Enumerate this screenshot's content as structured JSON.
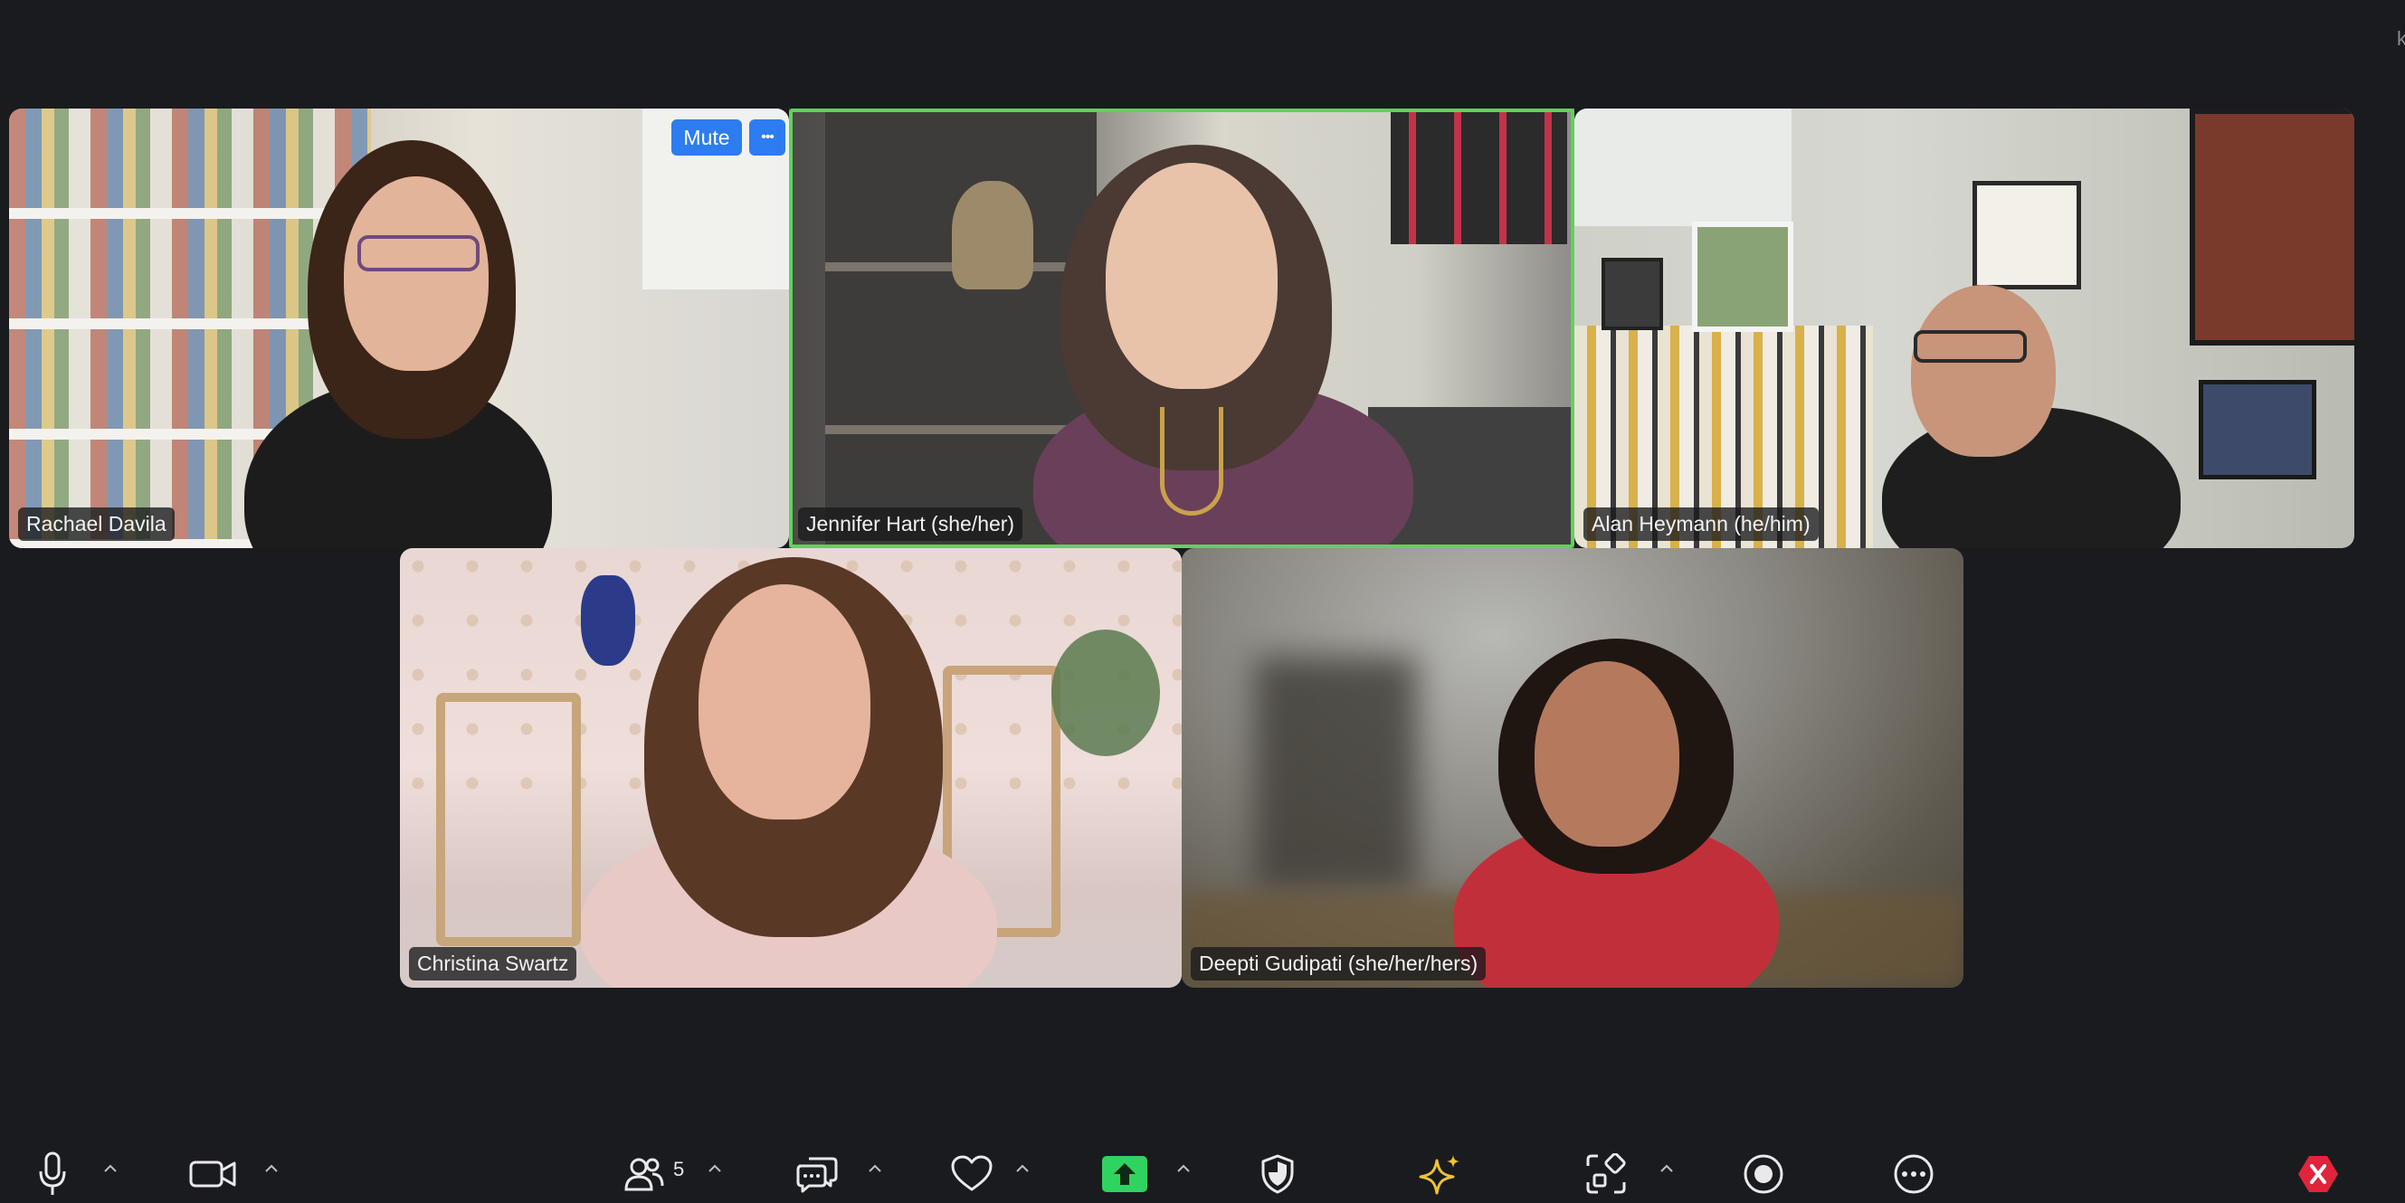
{
  "window": {
    "edge_text": "k"
  },
  "participants": [
    {
      "name": "Rachael Davila",
      "hover_buttons": {
        "mute": "Mute",
        "more": "•••"
      }
    },
    {
      "name": "Jennifer Hart (she/her)",
      "active_speaker": true
    },
    {
      "name": "Alan Heymann (he/him)"
    },
    {
      "name": "Christina Swartz"
    },
    {
      "name": "Deepti Gudipati (she/her/hers)"
    }
  ],
  "toolbar": {
    "participants_count": "5",
    "icons": [
      "microphone-icon",
      "video-camera-icon",
      "participants-icon",
      "chat-icon",
      "reactions-heart-icon",
      "share-screen-icon",
      "security-shield-icon",
      "ai-companion-sparkle-icon",
      "apps-icon",
      "record-icon",
      "more-icon",
      "end-meeting-icon"
    ]
  },
  "colors": {
    "background": "#1a1b1f",
    "active_speaker_border": "#5fd35a",
    "mute_button": "#2d7cf0",
    "share_button": "#2fd35f",
    "end_meeting": "#e0243a",
    "ai_sparkle": "#f1c232"
  }
}
